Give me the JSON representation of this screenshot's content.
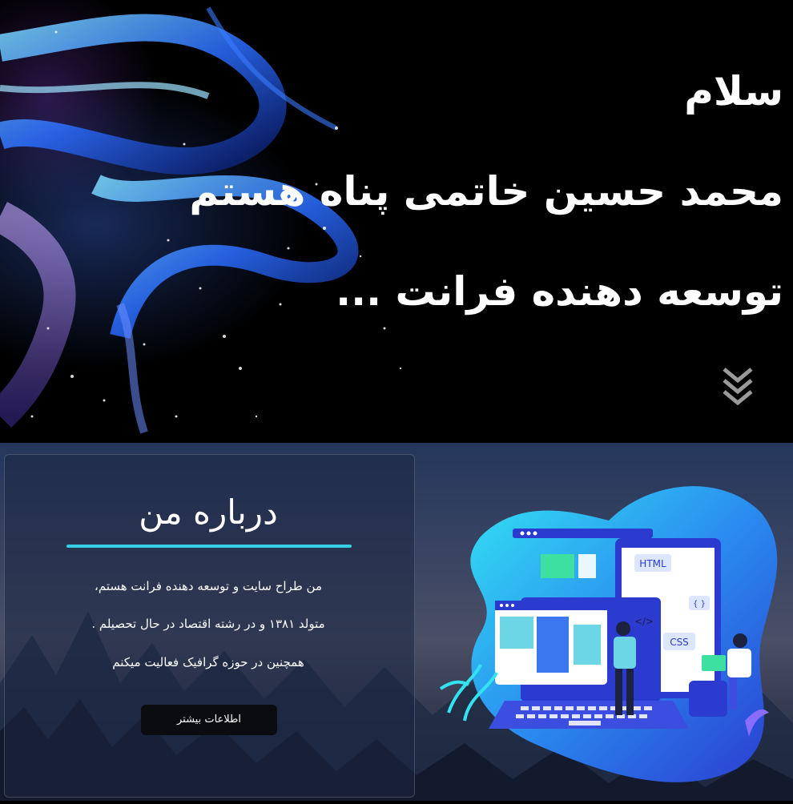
{
  "hero": {
    "greeting": "سلام",
    "name_line": "محمد حسین خاتمی پناه هستم",
    "role_line": "توسعه دهنده فرانت ..."
  },
  "about": {
    "title": "درباره من",
    "lines": [
      "من طراح سایت و توسعه دهنده فرانت هستم،",
      "متولد ۱۳۸۱ و در رشته اقتصاد در حال تحصیلم .",
      "همچنین در حوزه گرافیک فعالیت میکنم"
    ],
    "button_label": "اطلاعات بیشتر"
  },
  "illustration": {
    "tags": [
      "HTML",
      "CSS",
      "{ }",
      "</>"
    ]
  },
  "colors": {
    "accent": "#35d0e6",
    "button_bg": "#0b0c10"
  }
}
